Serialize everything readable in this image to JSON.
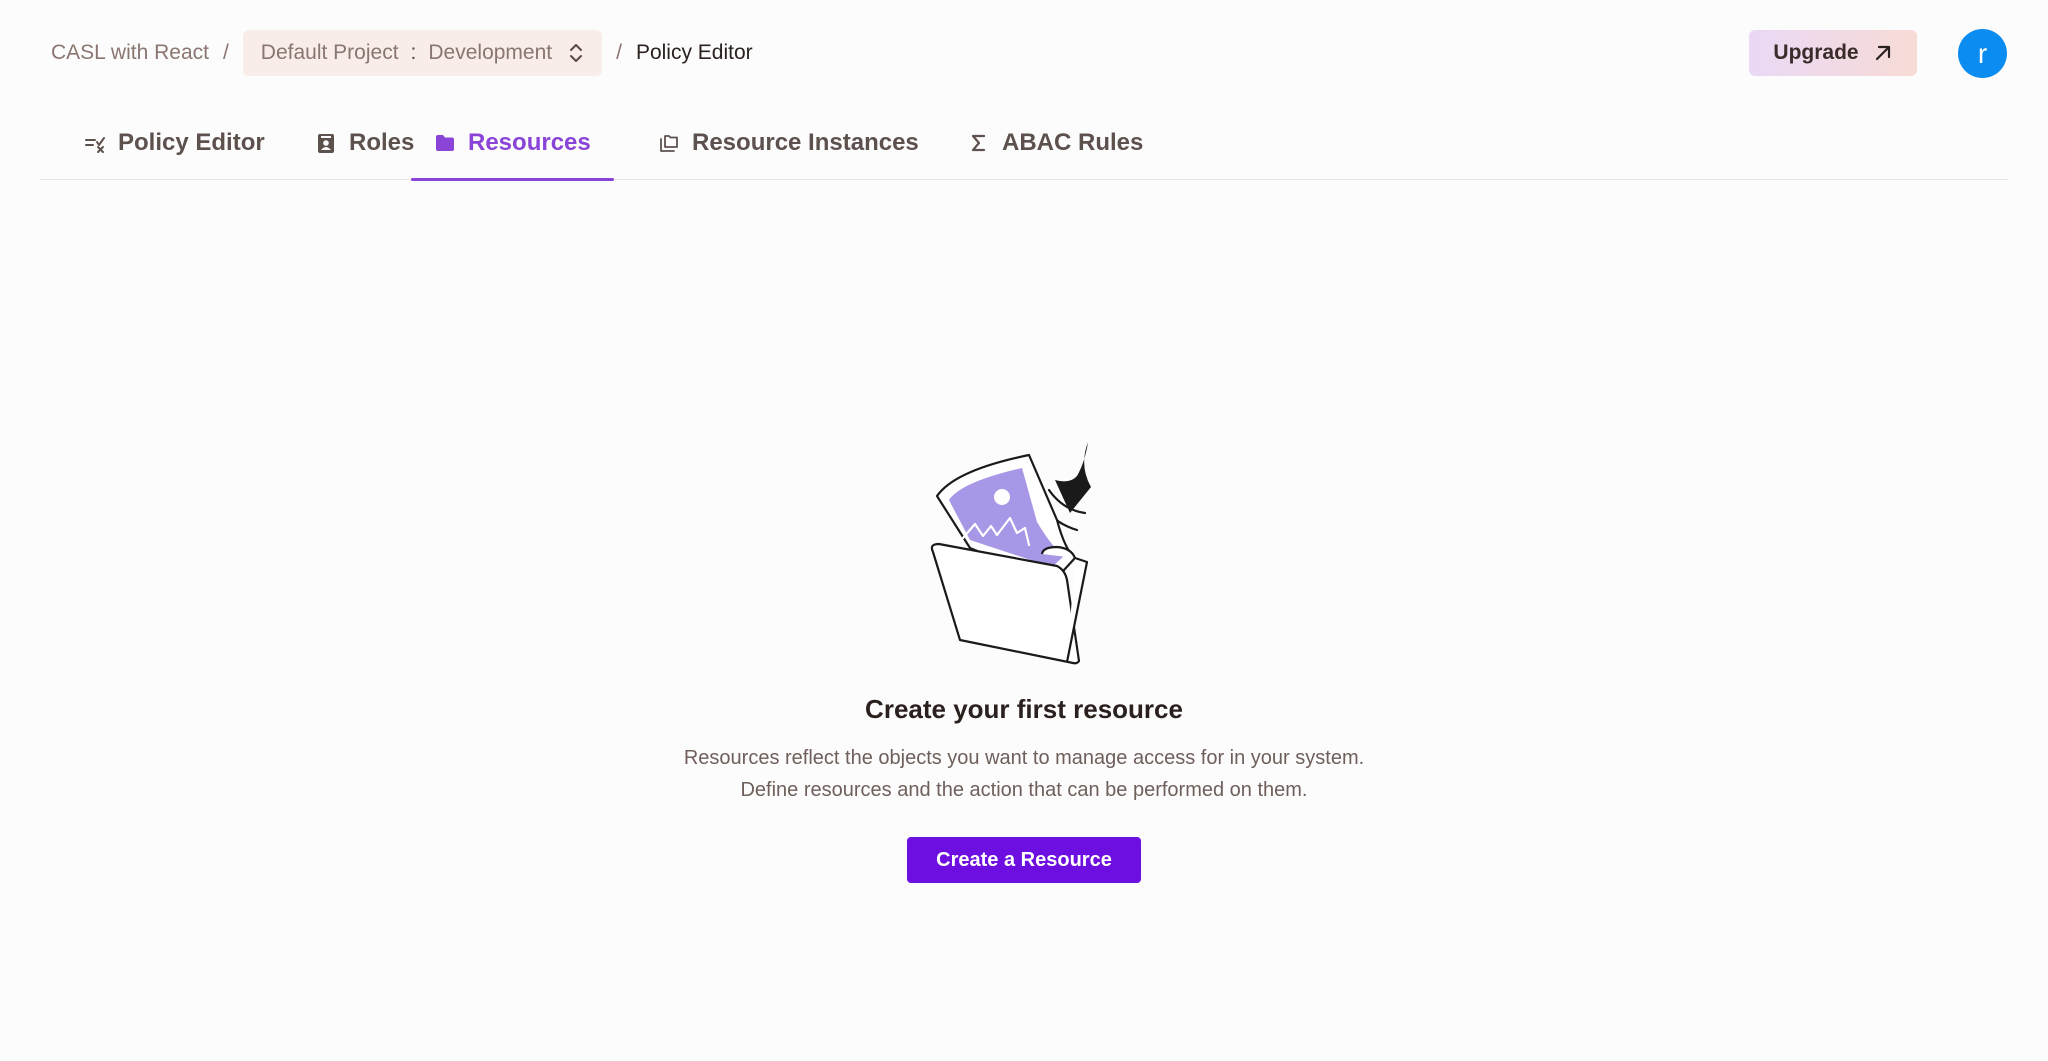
{
  "breadcrumb": {
    "org": "CASL with React",
    "separator": "/",
    "project": "Default Project",
    "environment_separator": ":",
    "environment": "Development",
    "current": "Policy Editor"
  },
  "header": {
    "upgrade_label": "Upgrade",
    "avatar_initial": "r"
  },
  "tabs": [
    {
      "label": "Policy Editor",
      "icon": "policy-editor-icon",
      "active": false
    },
    {
      "label": "Roles",
      "icon": "roles-icon",
      "active": false
    },
    {
      "label": "Resources",
      "icon": "folder-icon",
      "active": true
    },
    {
      "label": "Resource Instances",
      "icon": "resource-instances-icon",
      "active": false
    },
    {
      "label": "ABAC Rules",
      "icon": "sigma-icon",
      "active": false
    }
  ],
  "empty_state": {
    "illustration": "folder-with-image-illustration",
    "title": "Create your first resource",
    "description": "Resources reflect the objects you want to manage access for in your system. Define resources and the action that can be performed on them.",
    "cta_label": "Create a Resource"
  },
  "colors": {
    "accent": "#8a45d8",
    "primary_button": "#6d0fe0",
    "avatar": "#0a8cf0",
    "project_select_bg": "#f8ede8"
  }
}
